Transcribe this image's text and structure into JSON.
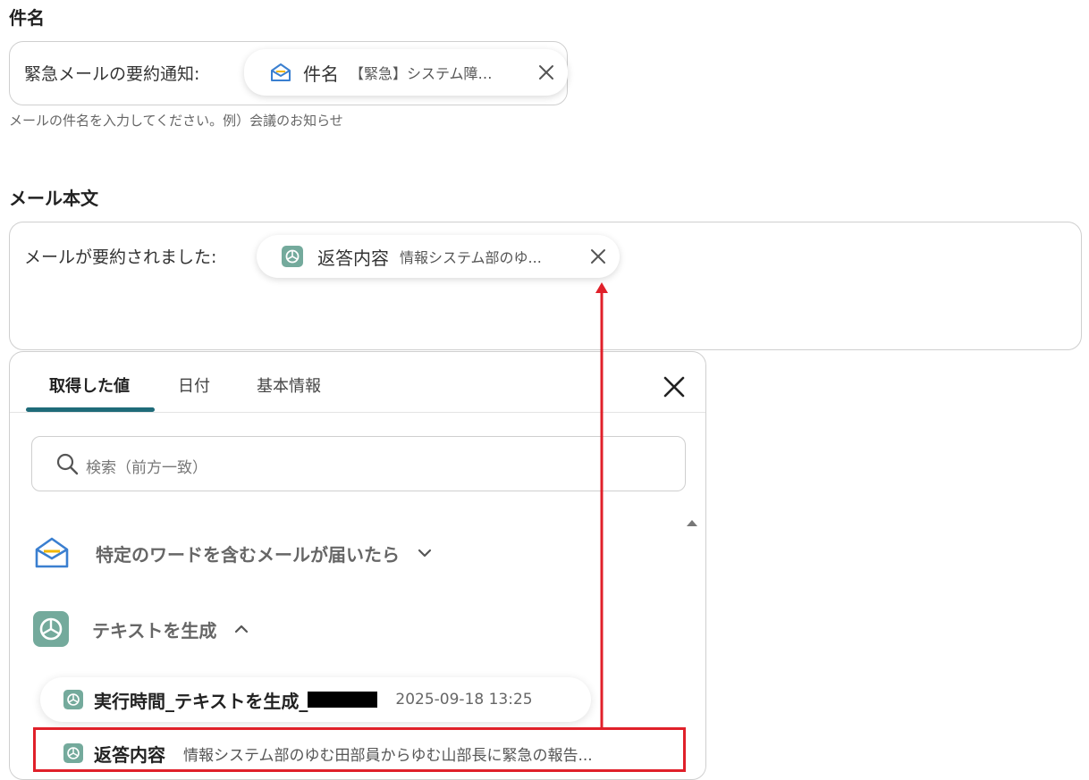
{
  "subject": {
    "label": "件名",
    "prefix": "緊急メールの要約通知:",
    "pill": {
      "name": "件名",
      "value": "【緊急】システム障害..."
    },
    "help": "メールの件名を入力してください。例）会議のお知らせ"
  },
  "body": {
    "label": "メール本文",
    "prefix": "メールが要約されました:",
    "pill": {
      "name": "返答内容",
      "value": "情報システム部のゆ..."
    }
  },
  "picker": {
    "tabs": [
      "取得した値",
      "日付",
      "基本情報"
    ],
    "active_tab": 0,
    "search_placeholder": "検索（前方一致）",
    "groups": [
      {
        "label": "特定のワードを含むメールが届いたら",
        "icon": "mail-icon",
        "expanded": false
      },
      {
        "label": "テキストを生成",
        "icon": "chatgpt-icon",
        "expanded": true
      }
    ],
    "items": [
      {
        "name": "実行時間_テキストを生成_",
        "value": "2025-09-18 13:25"
      },
      {
        "name": "返答内容",
        "value": "情報システム部のゆむ田部員からゆむ山部長に緊急の報告..."
      }
    ]
  },
  "colors": {
    "accent": "#1f6b79",
    "annotation_red": "#e0202a",
    "chatgpt_green": "#74aa9c",
    "mail_blue": "#3a7fd0",
    "mail_yellow": "#f2b705"
  }
}
